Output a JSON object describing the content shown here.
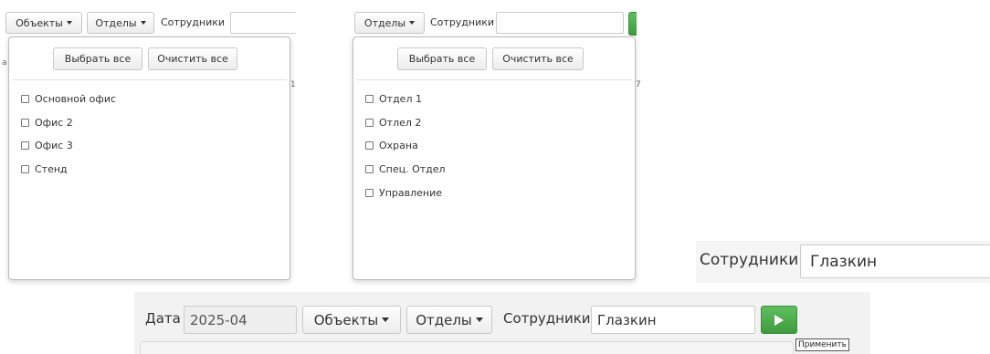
{
  "panel1": {
    "objects_dropdown": "Объекты",
    "departments_dropdown": "Отделы",
    "employees_label": "Сотрудники",
    "employees_value": "",
    "select_all": "Выбрать все",
    "clear_all": "Очистить все",
    "items": [
      "Основной офис",
      "Офис 2",
      "Офис 3",
      "Стенд"
    ]
  },
  "panel2": {
    "departments_dropdown": "Отделы",
    "employees_label": "Сотрудники",
    "employees_value": "",
    "select_all": "Выбрать все",
    "clear_all": "Очистить все",
    "items": [
      "Отдел 1",
      "Отлел 2",
      "Охрана",
      "Спец. Отдел",
      "Управление"
    ]
  },
  "panel3": {
    "employees_label": "Сотрудники",
    "employees_value": "Глазкин"
  },
  "toolbar": {
    "date_label": "Дата",
    "date_value": "2025-04",
    "objects_dropdown": "Объекты",
    "departments_dropdown": "Отделы",
    "employees_label": "Сотрудники",
    "employees_value": "Глазкин",
    "apply_tooltip": "Применить"
  },
  "colors": {
    "apply_button": "#4cae4c",
    "toolbar_bg": "#f2f2f2"
  }
}
